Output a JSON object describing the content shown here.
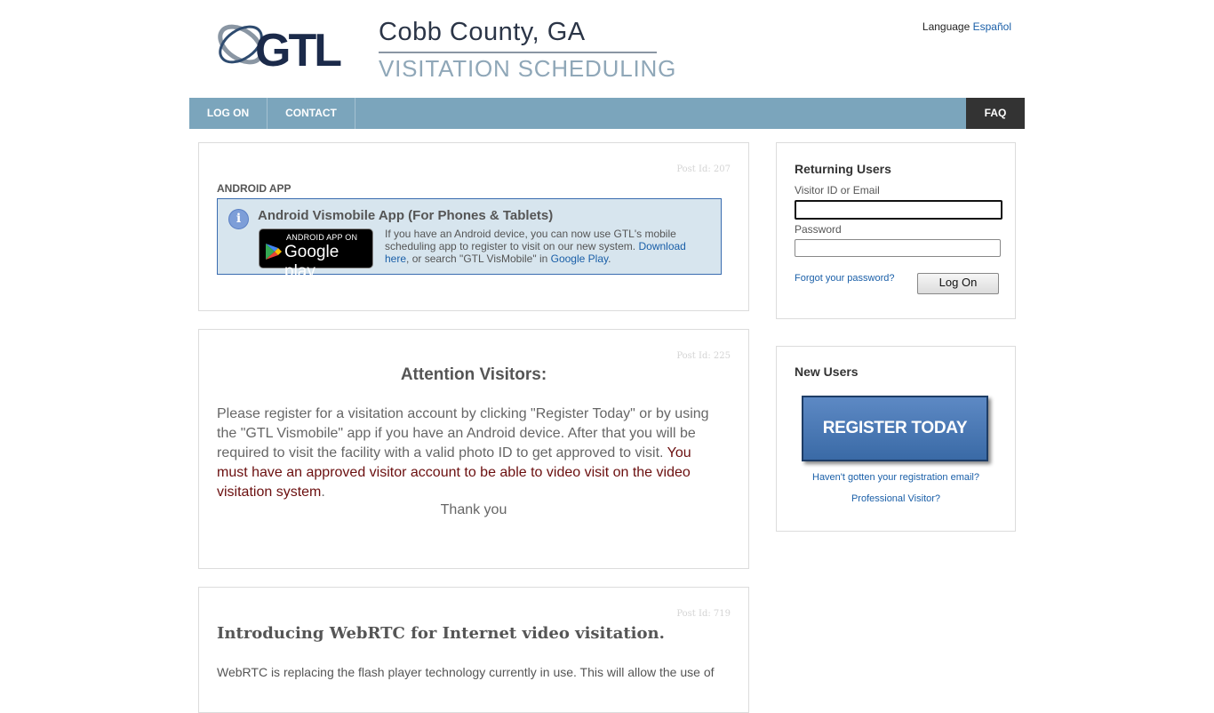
{
  "header": {
    "logo_text": "GTL",
    "county_title": "Cobb County, GA",
    "subtitle": "VISITATION SCHEDULING",
    "language_label": "Language",
    "language_link": "Español"
  },
  "nav": {
    "logon": "LOG ON",
    "contact": "CONTACT",
    "faq": "FAQ"
  },
  "post_android": {
    "post_id": "Post Id: 207",
    "heading": "ANDROID APP",
    "box_title": "Android Vismobile App (For Phones & Tablets)",
    "badge_top": "ANDROID APP ON",
    "badge_bottom": "Google play",
    "text_1": "If you have an Android device, you can now use GTL's mobile scheduling app to register to visit on our new system. ",
    "link_download": "Download here",
    "text_2": ", or search \"GTL VisMobile\" in ",
    "link_play": "Google Play",
    "text_3": "."
  },
  "post_attention": {
    "post_id": "Post Id: 225",
    "heading": "Attention Visitors:",
    "body": "Please register for a visitation account by clicking \"Register Today\" or by using the \"GTL Vismobile\" app if you have an Android device. After that you will be required to visit the facility with a valid photo ID to get approved to visit. ",
    "warning": "You must have an approved visitor account to be able to video visit on the video visitation system",
    "warning_end": ".",
    "thanks": "Thank you"
  },
  "post_webrtc": {
    "post_id": "Post Id: 719",
    "heading": "Introducing WebRTC for Internet video visitation.",
    "body": "WebRTC is replacing the flash player technology currently in use. This will allow the use of"
  },
  "login": {
    "heading": "Returning Users",
    "id_label": "Visitor ID or Email",
    "id_value": "",
    "password_label": "Password",
    "password_value": "",
    "forgot": "Forgot your password?",
    "button": "Log On"
  },
  "new_users": {
    "heading": "New Users",
    "register_button": "REGISTER TODAY",
    "haven_link": "Haven't gotten your registration email?",
    "professional_link": "Professional Visitor?"
  },
  "colors": {
    "nav_bg": "#7ba5bc",
    "faq_bg": "#333333",
    "link": "#1a5fa8",
    "info_box_bg": "#d7e5ee",
    "register_bg": "#4a78b4",
    "warning_text": "#6b0f0f"
  }
}
